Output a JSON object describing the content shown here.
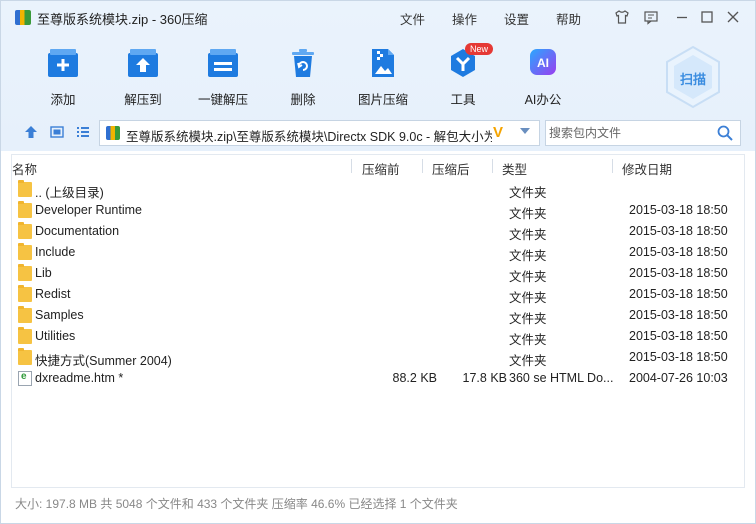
{
  "window": {
    "title": "至尊版系统模块.zip - 360压缩"
  },
  "menu": [
    "文件",
    "操作",
    "设置",
    "帮助"
  ],
  "toolbar": [
    {
      "label": "添加",
      "icon": "add-icon"
    },
    {
      "label": "解压到",
      "icon": "extract-to-icon"
    },
    {
      "label": "一键解压",
      "icon": "one-click-extract-icon"
    },
    {
      "label": "删除",
      "icon": "delete-icon"
    },
    {
      "label": "图片压缩",
      "icon": "image-compress-icon"
    },
    {
      "label": "工具",
      "icon": "tools-icon",
      "badge": "New"
    },
    {
      "label": "AI办公",
      "icon": "ai-office-icon",
      "icon_text": "AI"
    }
  ],
  "scan": {
    "label": "扫描"
  },
  "address": {
    "path": "至尊版系统模块.zip\\至尊版系统模块\\Directx SDK 9.0c - 解包大小为",
    "vmark": "V"
  },
  "search": {
    "placeholder": "搜索包内文件"
  },
  "columns": {
    "name": "名称",
    "compressed": "压缩前",
    "original": "压缩后",
    "type": "类型",
    "modified": "修改日期"
  },
  "files": [
    {
      "name": ".. (上级目录)",
      "compressed": "",
      "original": "",
      "type": "文件夹",
      "modified": "",
      "kind": "folder"
    },
    {
      "name": "Developer Runtime",
      "compressed": "",
      "original": "",
      "type": "文件夹",
      "modified": "2015-03-18 18:50",
      "kind": "folder"
    },
    {
      "name": "Documentation",
      "compressed": "",
      "original": "",
      "type": "文件夹",
      "modified": "2015-03-18 18:50",
      "kind": "folder"
    },
    {
      "name": "Include",
      "compressed": "",
      "original": "",
      "type": "文件夹",
      "modified": "2015-03-18 18:50",
      "kind": "folder"
    },
    {
      "name": "Lib",
      "compressed": "",
      "original": "",
      "type": "文件夹",
      "modified": "2015-03-18 18:50",
      "kind": "folder"
    },
    {
      "name": "Redist",
      "compressed": "",
      "original": "",
      "type": "文件夹",
      "modified": "2015-03-18 18:50",
      "kind": "folder"
    },
    {
      "name": "Samples",
      "compressed": "",
      "original": "",
      "type": "文件夹",
      "modified": "2015-03-18 18:50",
      "kind": "folder"
    },
    {
      "name": "Utilities",
      "compressed": "",
      "original": "",
      "type": "文件夹",
      "modified": "2015-03-18 18:50",
      "kind": "folder"
    },
    {
      "name": "快捷方式(Summer 2004)",
      "compressed": "",
      "original": "",
      "type": "文件夹",
      "modified": "2015-03-18 18:50",
      "kind": "folder"
    },
    {
      "name": "dxreadme.htm *",
      "compressed": "88.2 KB",
      "original": "17.8 KB",
      "type": "360 se HTML Do...",
      "modified": "2004-07-26 10:03",
      "kind": "htm"
    }
  ],
  "status": "大小: 197.8 MB 共 5048 个文件和 433 个文件夹 压缩率 46.6% 已经选择 1 个文件夹",
  "colors": {
    "accent": "#1e7be0",
    "folder": "#f6c343",
    "badge": "#e53935",
    "vmark": "#f5a400"
  }
}
